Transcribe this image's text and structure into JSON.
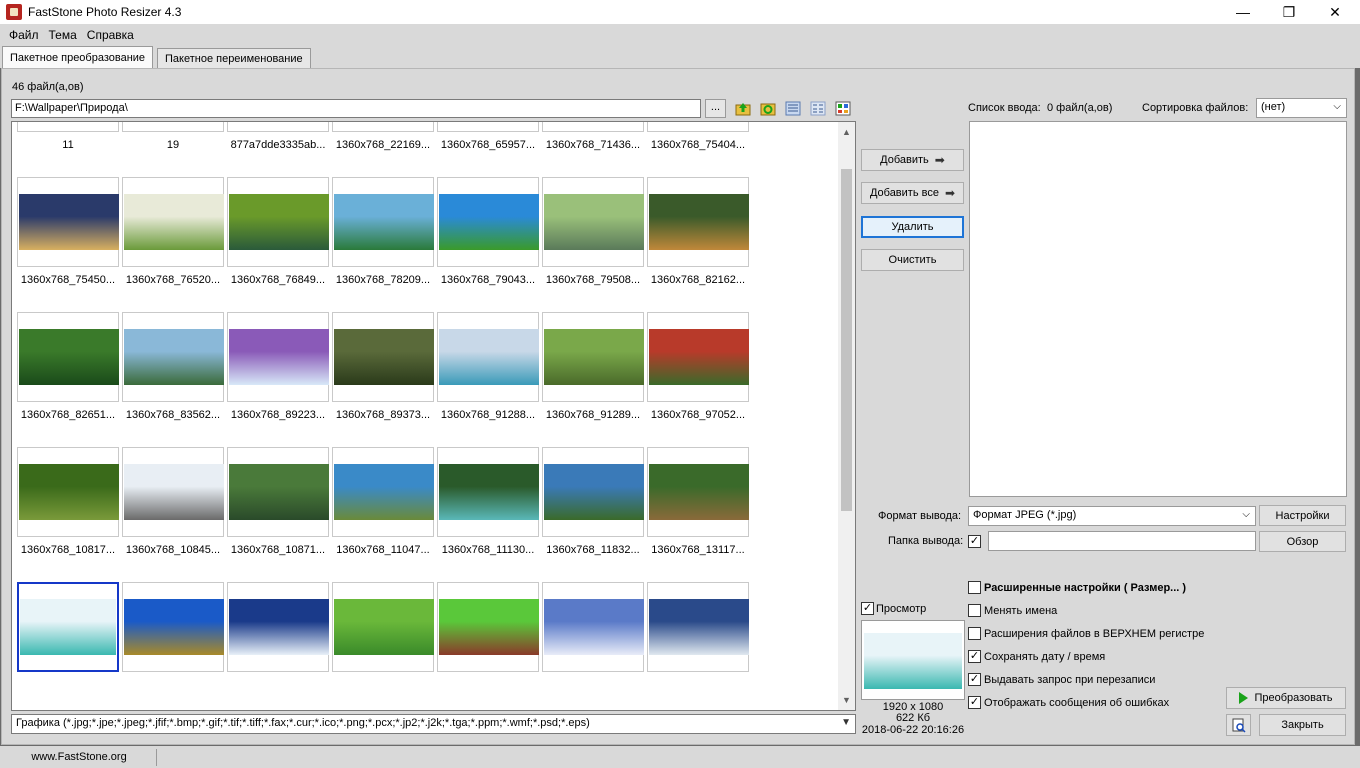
{
  "window": {
    "title": "FastStone Photo Resizer 4.3",
    "min_glyph": "—",
    "max_glyph": "❐",
    "close_glyph": "✕"
  },
  "menu": [
    "Файл",
    "Тема",
    "Справка"
  ],
  "tabs": [
    "Пакетное преобразование",
    "Пакетное переименование"
  ],
  "file_count": "46 файл(а,ов)",
  "path": "F:\\Wallpaper\\Природа\\",
  "browse_label": "...",
  "toolbar_icons": [
    "folder-up-icon",
    "refresh-icon",
    "list-view-icon",
    "details-view-icon",
    "thumbnail-view-icon"
  ],
  "thumbnails": [
    {
      "label": "11",
      "colors": [
        "#7fb04a",
        "#2e6b22"
      ]
    },
    {
      "label": "19",
      "colors": [
        "#9bb4c4",
        "#5c6e4a"
      ]
    },
    {
      "label": "877a7dde3335ab...",
      "colors": [
        "#e0a020",
        "#3a6a2a"
      ]
    },
    {
      "label": "1360x768_22169...",
      "colors": [
        "#1a2a5a",
        "#0d1535"
      ]
    },
    {
      "label": "1360x768_65957...",
      "colors": [
        "#6aa83a",
        "#2e5a1a"
      ]
    },
    {
      "label": "1360x768_71436...",
      "colors": [
        "#b8742a",
        "#5a3a14"
      ]
    },
    {
      "label": "1360x768_75404...",
      "colors": [
        "#d8a020",
        "#385a20"
      ]
    },
    {
      "label": "1360x768_75450...",
      "colors": [
        "#2a3a6a",
        "#d8b060"
      ]
    },
    {
      "label": "1360x768_76520...",
      "colors": [
        "#e8ead8",
        "#6a9a3a"
      ]
    },
    {
      "label": "1360x768_76849...",
      "colors": [
        "#6a9a2a",
        "#2a5a3a"
      ]
    },
    {
      "label": "1360x768_78209...",
      "colors": [
        "#6ab0d8",
        "#2a7a3a"
      ]
    },
    {
      "label": "1360x768_79043...",
      "colors": [
        "#2a8ad8",
        "#3a9a2a"
      ]
    },
    {
      "label": "1360x768_79508...",
      "colors": [
        "#9ac07a",
        "#5a7a5a"
      ]
    },
    {
      "label": "1360x768_82162...",
      "colors": [
        "#3a5a2a",
        "#c0883a"
      ]
    },
    {
      "label": "1360x768_82651...",
      "colors": [
        "#3a7a2a",
        "#1a4a1a"
      ]
    },
    {
      "label": "1360x768_83562...",
      "colors": [
        "#8ab8d8",
        "#3a6a3a"
      ]
    },
    {
      "label": "1360x768_89223...",
      "colors": [
        "#8a5ab8",
        "#d8e8f8"
      ]
    },
    {
      "label": "1360x768_89373...",
      "colors": [
        "#5a6a3a",
        "#2a3a1a"
      ]
    },
    {
      "label": "1360x768_91288...",
      "colors": [
        "#c8d8e8",
        "#3a9ab8"
      ]
    },
    {
      "label": "1360x768_91289...",
      "colors": [
        "#7aa84a",
        "#4a6a2a"
      ]
    },
    {
      "label": "1360x768_97052...",
      "colors": [
        "#b83a2a",
        "#3a6a2a"
      ]
    },
    {
      "label": "1360x768_10817...",
      "colors": [
        "#3a6a1a",
        "#7a9a3a"
      ]
    },
    {
      "label": "1360x768_10845...",
      "colors": [
        "#e8eef4",
        "#6a6a6a"
      ]
    },
    {
      "label": "1360x768_10871...",
      "colors": [
        "#4a7a3a",
        "#2a4a2a"
      ]
    },
    {
      "label": "1360x768_11047...",
      "colors": [
        "#3a8ac8",
        "#6a8a3a"
      ]
    },
    {
      "label": "1360x768_11130...",
      "colors": [
        "#2a5a2a",
        "#5ab8b8"
      ]
    },
    {
      "label": "1360x768_11832...",
      "colors": [
        "#3a7ab8",
        "#3a6a2a"
      ]
    },
    {
      "label": "1360x768_13117...",
      "colors": [
        "#3a6a2a",
        "#8a6a3a"
      ]
    },
    {
      "label": "",
      "colors": [
        "#e8f4f8",
        "#3ab8b0"
      ],
      "selected": true
    },
    {
      "label": "",
      "colors": [
        "#1a5ac8",
        "#a88a2a"
      ]
    },
    {
      "label": "",
      "colors": [
        "#1a3a8a",
        "#e8f0f8"
      ]
    },
    {
      "label": "",
      "colors": [
        "#6ab83a",
        "#3a8a2a"
      ]
    },
    {
      "label": "",
      "colors": [
        "#5ac83a",
        "#8a3a2a"
      ]
    },
    {
      "label": "",
      "colors": [
        "#5a7ac8",
        "#e8ecf8"
      ]
    },
    {
      "label": "",
      "colors": [
        "#2a4a8a",
        "#e0e8f0"
      ]
    }
  ],
  "filter": "Графика (*.jpg;*.jpe;*.jpeg;*.jfif;*.bmp;*.gif;*.tif;*.tiff;*.fax;*.cur;*.ico;*.png;*.pcx;*.jp2;*.j2k;*.tga;*.ppm;*.wmf;*.psd;*.eps)",
  "buttons": {
    "add": "Добавить",
    "add_all": "Добавить все",
    "remove": "Удалить",
    "clear": "Очистить",
    "settings": "Настройки",
    "browse_output": "Обзор",
    "convert": "Преобразовать",
    "close": "Закрыть"
  },
  "input_list": {
    "label": "Список ввода:",
    "count": "0 файл(а,ов)",
    "sort_label": "Сортировка файлов:",
    "sort_value": "(нет)"
  },
  "output": {
    "format_label": "Формат вывода:",
    "format_value": "Формат JPEG (*.jpg)",
    "folder_label": "Папка вывода:",
    "folder_checked": true,
    "folder_value": ""
  },
  "options": [
    {
      "label": "Расширенные настройки ( Размер... )",
      "checked": false,
      "bold": true
    },
    {
      "label": "Менять имена",
      "checked": false
    },
    {
      "label": "Расширения файлов в ВЕРХНЕМ регистре",
      "checked": false
    },
    {
      "label": "Сохранять дату / время",
      "checked": true
    },
    {
      "label": "Выдавать запрос при перезаписи",
      "checked": true
    },
    {
      "label": "Отображать сообщения об ошибках",
      "checked": true
    }
  ],
  "preview": {
    "label": "Просмотр",
    "checked": true,
    "dimensions": "1920 x 1080",
    "size": "622 Кб",
    "date": "2018-06-22 20:16:26",
    "colors": [
      "#e8f4f8",
      "#3ab8b0"
    ]
  },
  "status": {
    "website": "www.FastStone.org"
  }
}
